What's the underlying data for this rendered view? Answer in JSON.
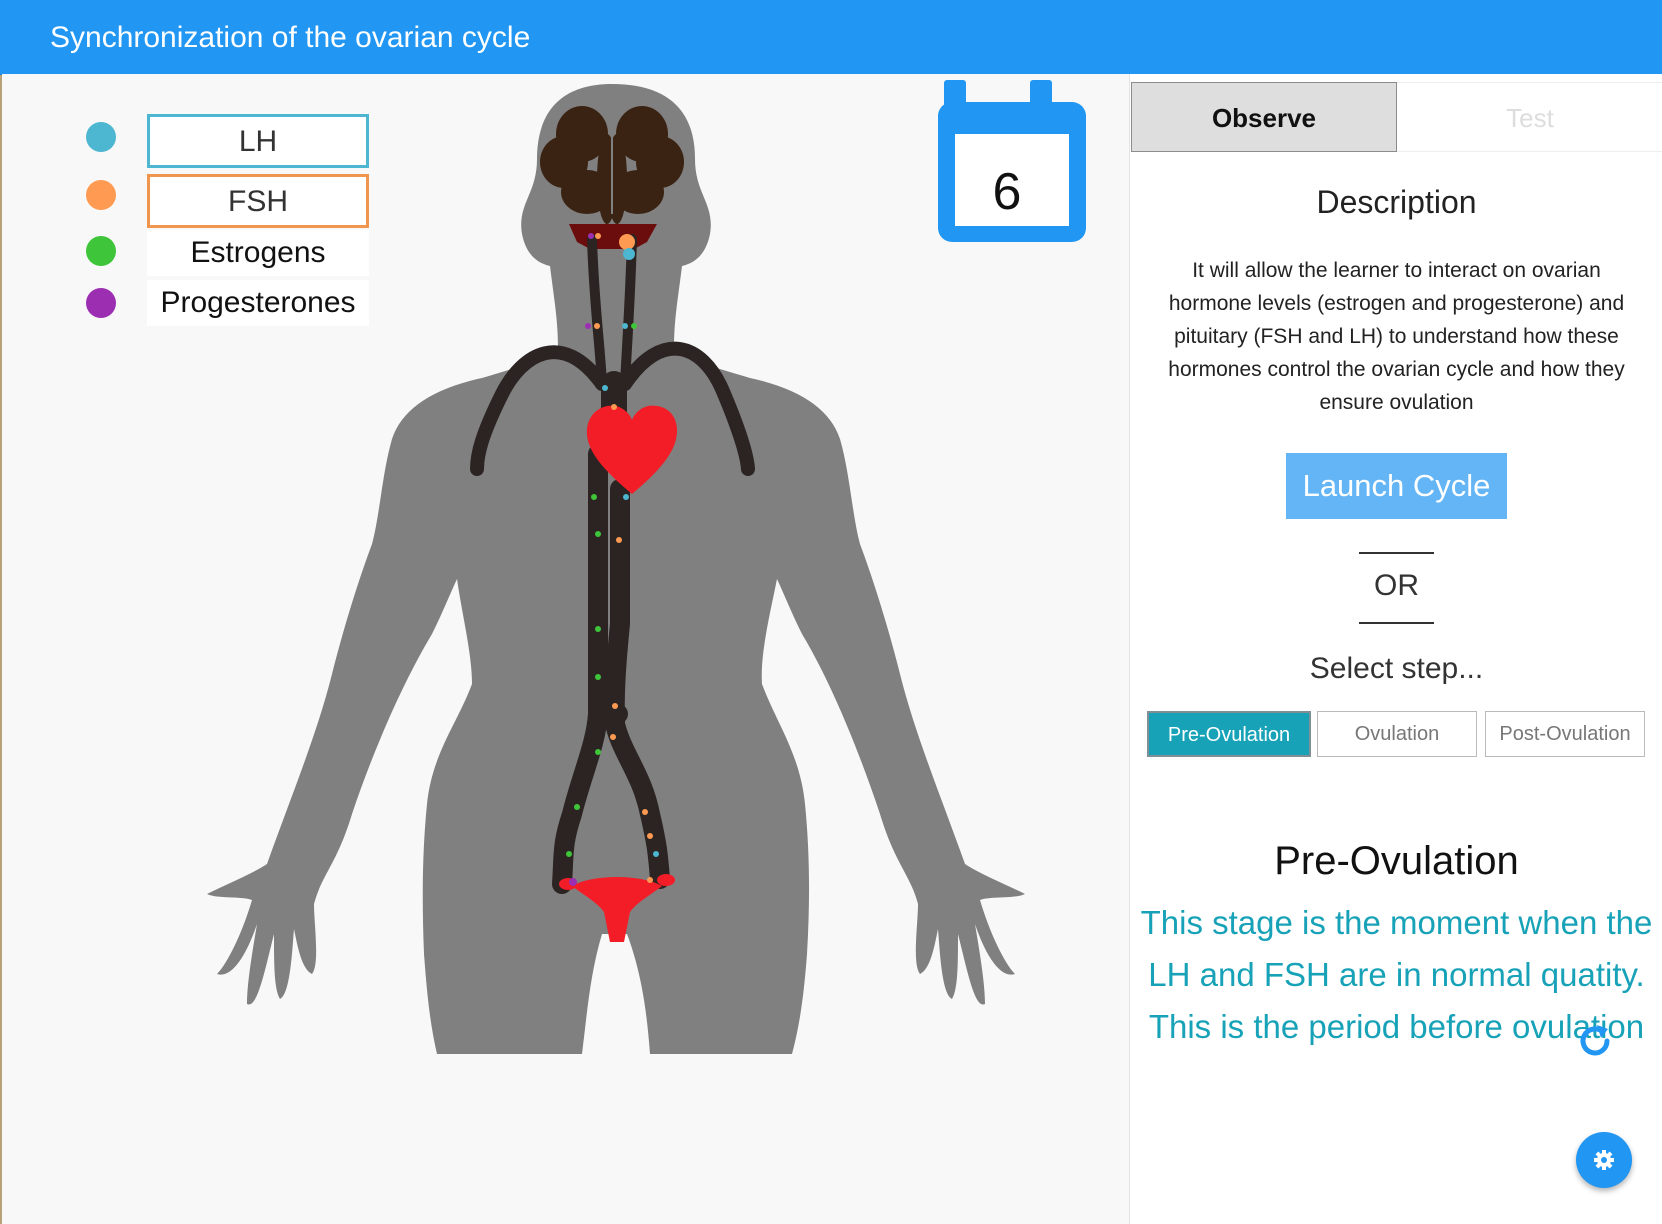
{
  "app": {
    "title": "Synchronization of the ovarian cycle"
  },
  "legend": {
    "items": [
      {
        "label": "LH",
        "color": "#4db6d0",
        "border": "#4db6d0"
      },
      {
        "label": "FSH",
        "color": "#ff9a52",
        "border": "#f0954e"
      },
      {
        "label": "Estrogens",
        "color": "#3ec53a",
        "border": ""
      },
      {
        "label": "Progesterones",
        "color": "#9c2fb1",
        "border": ""
      }
    ]
  },
  "calendar": {
    "day": "6",
    "color": "#2196f3"
  },
  "colors": {
    "header": "#2196f3",
    "body": "#808080",
    "vessel": "#2b2422",
    "heart": "#f31d28",
    "brain": "#3a2312",
    "accent": "#17a2b8"
  },
  "tabs": [
    {
      "label": "Observe",
      "active": true
    },
    {
      "label": "Test",
      "active": false
    }
  ],
  "description": {
    "title": "Description",
    "text": "It will allow the learner to interact on ovarian hormone levels (estrogen and progesterone) and pituitary (FSH and LH) to understand how these hormones control the ovarian cycle and how they ensure ovulation"
  },
  "launch_label": "Launch Cycle",
  "or_label": "OR",
  "select_label": "Select step...",
  "steps": [
    {
      "label": "Pre-Ovulation",
      "active": true
    },
    {
      "label": "Ovulation",
      "active": false
    },
    {
      "label": "Post-Ovulation",
      "active": false
    }
  ],
  "stage": {
    "title": "Pre-Ovulation",
    "text": "This stage is the moment when the LH and FSH are in normal quatity. This is the period before ovulation"
  },
  "icons": {
    "refresh": "refresh-icon",
    "settings": "gear-icon",
    "calendar": "calendar-icon"
  }
}
